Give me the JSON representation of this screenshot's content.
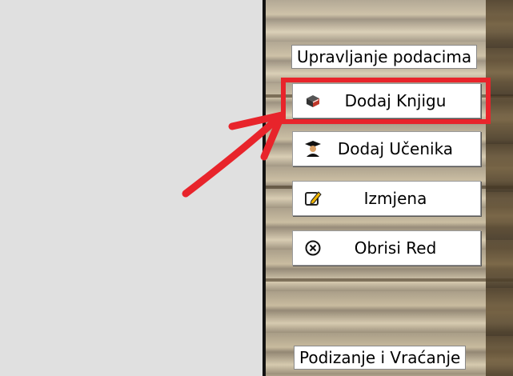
{
  "panel": {
    "section_top": "Upravljanje podacima",
    "section_bottom": "Podizanje i Vraćanje"
  },
  "buttons": [
    {
      "label": "Dodaj Knjigu",
      "icon": "book-icon"
    },
    {
      "label": "Dodaj Učenika",
      "icon": "student-icon"
    },
    {
      "label": "Izmjena",
      "icon": "edit-icon"
    },
    {
      "label": "Obrisi Red",
      "icon": "delete-icon"
    }
  ],
  "annotation": {
    "highlight_color": "#e8242b",
    "arrow_color": "#e8242b"
  }
}
